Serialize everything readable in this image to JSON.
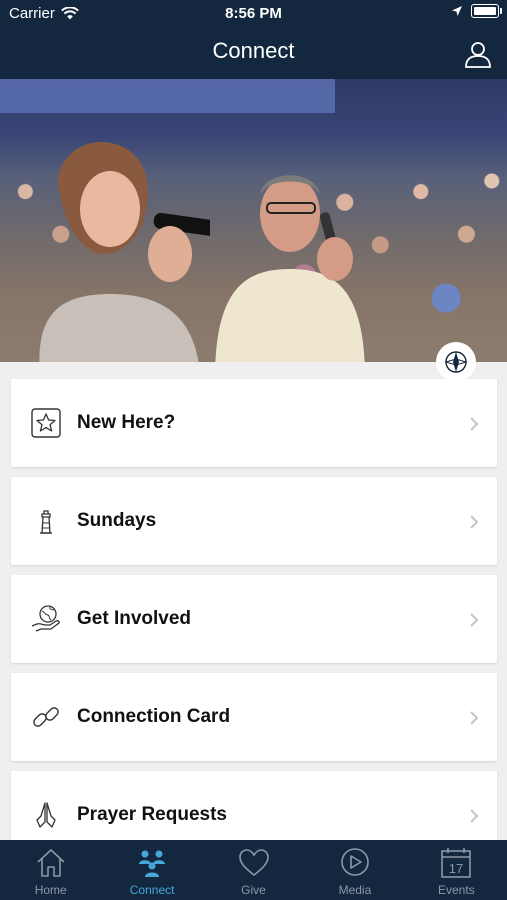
{
  "status_bar": {
    "carrier": "Carrier",
    "time": "8:56 PM"
  },
  "nav": {
    "title": "Connect"
  },
  "menu": {
    "items": [
      {
        "label": "New Here?",
        "icon": "star-icon"
      },
      {
        "label": "Sundays",
        "icon": "lighthouse-icon"
      },
      {
        "label": "Get Involved",
        "icon": "globe-hand-icon"
      },
      {
        "label": "Connection Card",
        "icon": "link-icon"
      },
      {
        "label": "Prayer Requests",
        "icon": "praying-hands-icon"
      }
    ]
  },
  "tabbar": {
    "active": "Connect",
    "tabs": [
      {
        "label": "Home",
        "icon": "home-icon"
      },
      {
        "label": "Connect",
        "icon": "people-icon"
      },
      {
        "label": "Give",
        "icon": "heart-icon"
      },
      {
        "label": "Media",
        "icon": "play-icon"
      },
      {
        "label": "Events",
        "icon": "calendar-icon"
      }
    ],
    "calendar_day": "17"
  },
  "colors": {
    "nav_bg": "#13273f",
    "active_tab": "#47a7d8",
    "inactive_tab": "#8e97a3"
  }
}
